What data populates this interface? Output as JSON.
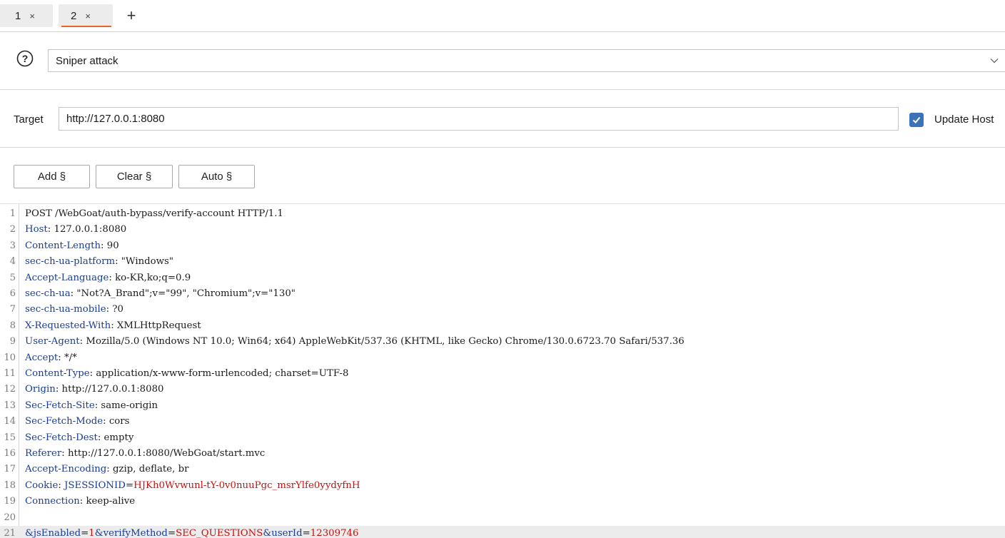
{
  "tabs": [
    {
      "label": "1",
      "close": "×"
    },
    {
      "label": "2",
      "close": "×"
    }
  ],
  "tab_add": "+",
  "attack": {
    "help": "?",
    "selected": "Sniper attack"
  },
  "target": {
    "label": "Target",
    "value": "http://127.0.0.1:8080",
    "update_host_label": "Update Host",
    "update_host_checked": true
  },
  "buttons": {
    "add": "Add §",
    "clear": "Clear §",
    "auto": "Auto §"
  },
  "request_lines": [
    {
      "n": "1",
      "segs": [
        {
          "t": "POST /WebGoat/auth-bypass/verify-account HTTP/1.1",
          "c": "v"
        }
      ]
    },
    {
      "n": "2",
      "segs": [
        {
          "t": "Host",
          "c": "k"
        },
        {
          "t": ": 127.0.0.1:8080",
          "c": "v"
        }
      ]
    },
    {
      "n": "3",
      "segs": [
        {
          "t": "Content-Length",
          "c": "k"
        },
        {
          "t": ": 90",
          "c": "v"
        }
      ]
    },
    {
      "n": "4",
      "segs": [
        {
          "t": "sec-ch-ua-platform",
          "c": "k"
        },
        {
          "t": ": \"Windows\"",
          "c": "v"
        }
      ]
    },
    {
      "n": "5",
      "segs": [
        {
          "t": "Accept-Language",
          "c": "k"
        },
        {
          "t": ": ko-KR,ko;q=0.9",
          "c": "v"
        }
      ]
    },
    {
      "n": "6",
      "segs": [
        {
          "t": "sec-ch-ua",
          "c": "k"
        },
        {
          "t": ": \"Not?A_Brand\";v=\"99\", \"Chromium\";v=\"130\"",
          "c": "v"
        }
      ]
    },
    {
      "n": "7",
      "segs": [
        {
          "t": "sec-ch-ua-mobile",
          "c": "k"
        },
        {
          "t": ": ?0",
          "c": "v"
        }
      ]
    },
    {
      "n": "8",
      "segs": [
        {
          "t": "X-Requested-With",
          "c": "k"
        },
        {
          "t": ": XMLHttpRequest",
          "c": "v"
        }
      ]
    },
    {
      "n": "9",
      "segs": [
        {
          "t": "User-Agent",
          "c": "k"
        },
        {
          "t": ": Mozilla/5.0 (Windows NT 10.0; Win64; x64) AppleWebKit/537.36 (KHTML, like Gecko) Chrome/130.0.6723.70 Safari/537.36",
          "c": "v"
        }
      ]
    },
    {
      "n": "10",
      "segs": [
        {
          "t": "Accept",
          "c": "k"
        },
        {
          "t": ": */*",
          "c": "v"
        }
      ]
    },
    {
      "n": "11",
      "segs": [
        {
          "t": "Content-Type",
          "c": "k"
        },
        {
          "t": ": application/x-www-form-urlencoded; charset=UTF-8",
          "c": "v"
        }
      ]
    },
    {
      "n": "12",
      "segs": [
        {
          "t": "Origin",
          "c": "k"
        },
        {
          "t": ": http://127.0.0.1:8080",
          "c": "v"
        }
      ]
    },
    {
      "n": "13",
      "segs": [
        {
          "t": "Sec-Fetch-Site",
          "c": "k"
        },
        {
          "t": ": same-origin",
          "c": "v"
        }
      ]
    },
    {
      "n": "14",
      "segs": [
        {
          "t": "Sec-Fetch-Mode",
          "c": "k"
        },
        {
          "t": ": cors",
          "c": "v"
        }
      ]
    },
    {
      "n": "15",
      "segs": [
        {
          "t": "Sec-Fetch-Dest",
          "c": "k"
        },
        {
          "t": ": empty",
          "c": "v"
        }
      ]
    },
    {
      "n": "16",
      "segs": [
        {
          "t": "Referer",
          "c": "k"
        },
        {
          "t": ": http://127.0.0.1:8080/WebGoat/start.mvc",
          "c": "v"
        }
      ]
    },
    {
      "n": "17",
      "segs": [
        {
          "t": "Accept-Encoding",
          "c": "k"
        },
        {
          "t": ": gzip, deflate, br",
          "c": "v"
        }
      ]
    },
    {
      "n": "18",
      "segs": [
        {
          "t": "Cookie",
          "c": "k"
        },
        {
          "t": ": ",
          "c": "v"
        },
        {
          "t": "JSESSIONID",
          "c": "k"
        },
        {
          "t": "=",
          "c": "v"
        },
        {
          "t": "HJKh0Wvwunl-tY-0v0nuuPgc_msrYlfe0yydyfnH",
          "c": "r"
        }
      ]
    },
    {
      "n": "19",
      "segs": [
        {
          "t": "Connection",
          "c": "k"
        },
        {
          "t": ": keep-alive",
          "c": "v"
        }
      ]
    },
    {
      "n": "20",
      "segs": []
    },
    {
      "n": "21",
      "segs": [
        {
          "t": "&jsEnabled",
          "c": "k"
        },
        {
          "t": "=",
          "c": "v"
        },
        {
          "t": "1",
          "c": "r"
        },
        {
          "t": "&verifyMethod",
          "c": "k"
        },
        {
          "t": "=",
          "c": "v"
        },
        {
          "t": "SEC_QUESTIONS",
          "c": "r"
        },
        {
          "t": "&userId",
          "c": "k"
        },
        {
          "t": "=",
          "c": "v"
        },
        {
          "t": "12309746",
          "c": "r"
        }
      ],
      "highlight": true
    }
  ],
  "colors": {
    "accent_tab_underline": "#e8662a",
    "checkbox_blue": "#3b73b9",
    "header_key_blue": "#1a3d8f",
    "value_red": "#c41212"
  }
}
